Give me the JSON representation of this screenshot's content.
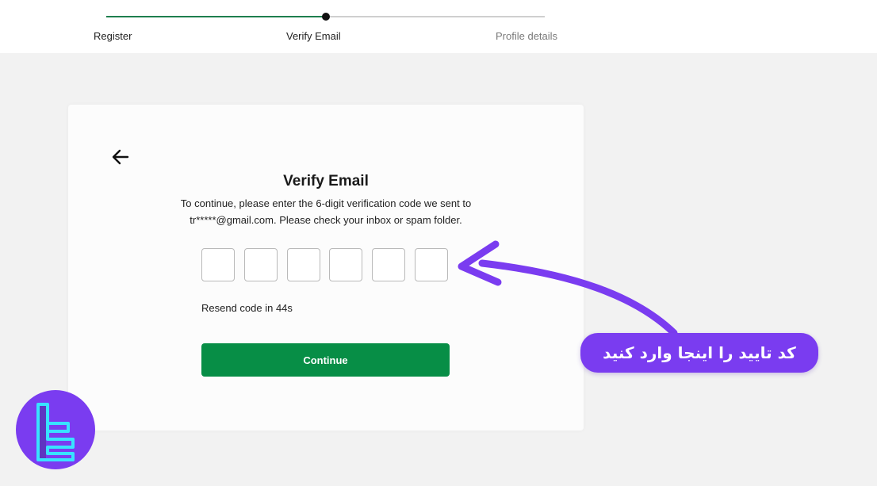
{
  "progress": {
    "steps": [
      {
        "label": "Register",
        "state": "done"
      },
      {
        "label": "Verify Email",
        "state": "current"
      },
      {
        "label": "Profile details",
        "state": "upcoming"
      }
    ],
    "fraction_complete": 0.5
  },
  "form": {
    "title": "Verify Email",
    "description": "To continue, please enter the 6-digit verification code we sent to tr*****@gmail.com. Please check your inbox or spam folder.",
    "code_digits": [
      "",
      "",
      "",
      "",
      "",
      ""
    ],
    "resend_text": "Resend code in 44s",
    "continue_label": "Continue"
  },
  "annotation": {
    "callout_text": "کد تایید را اینجا وارد کنید"
  },
  "icons": {
    "back": "back-arrow-icon",
    "logo": "brand-logo-icon"
  },
  "colors": {
    "primary_green": "#078e46",
    "progress_green": "#1e7f4e",
    "annotation_purple": "#7a3cf0",
    "logo_cyan": "#38e3ff"
  }
}
